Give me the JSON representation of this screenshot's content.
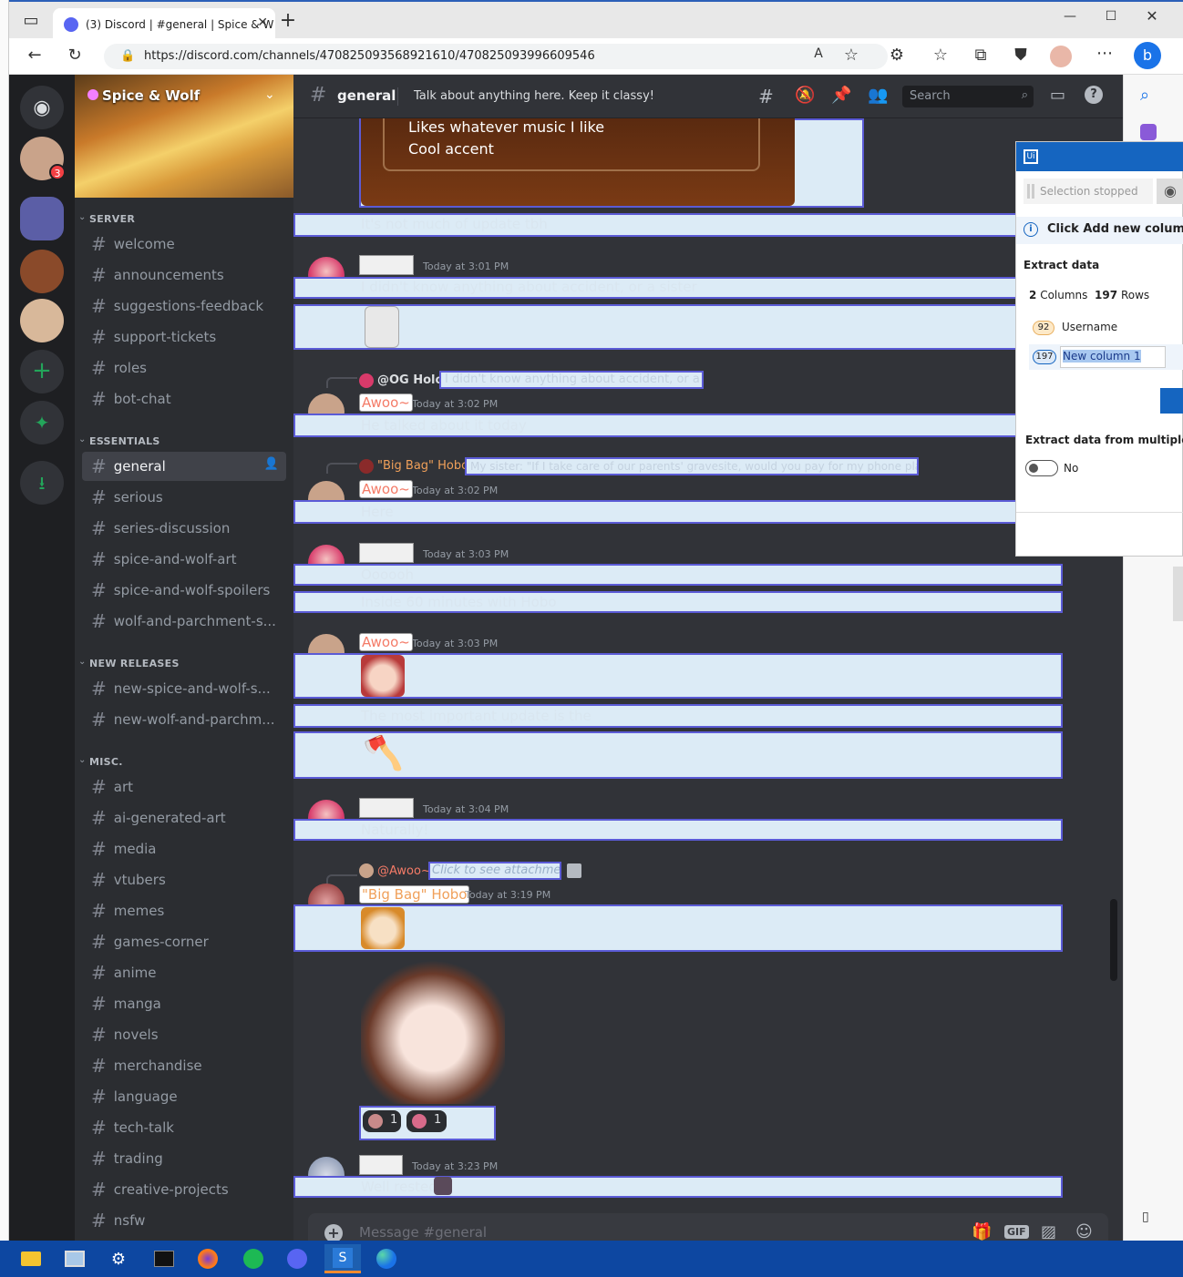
{
  "browser": {
    "tab_title": "(3) Discord | #general | Spice & W",
    "url": "https://discord.com/channels/470825093568921610/470825093996609546"
  },
  "server": {
    "name": "Spice & Wolf"
  },
  "guild_badge": "3",
  "categories": [
    {
      "name": "SERVER",
      "channels": [
        "welcome",
        "announcements",
        "suggestions-feedback",
        "support-tickets",
        "roles",
        "bot-chat"
      ]
    },
    {
      "name": "ESSENTIALS",
      "channels": [
        "general",
        "serious",
        "series-discussion",
        "spice-and-wolf-art",
        "spice-and-wolf-spoilers",
        "wolf-and-parchment-s..."
      ]
    },
    {
      "name": "NEW RELEASES",
      "channels": [
        "new-spice-and-wolf-s...",
        "new-wolf-and-parchm..."
      ]
    },
    {
      "name": "MISC.",
      "channels": [
        "art",
        "ai-generated-art",
        "media",
        "vtubers",
        "memes",
        "games-corner",
        "anime",
        "manga",
        "novels",
        "merchandise",
        "language",
        "tech-talk",
        "trading",
        "creative-projects",
        "nsfw"
      ]
    }
  ],
  "header": {
    "channel": "general",
    "topic": "Talk about anything here. Keep it classy!",
    "search_placeholder": "Search"
  },
  "messages": {
    "card_line1": "Likes whatever music I like",
    "card_line2": "Cool accent",
    "m1": "It's not much of update tbh",
    "m2_ts": "Today at 3:01 PM",
    "m2": "I didn't know anything about accident, or a sister",
    "r3_user": "@OG Holo",
    "r3_text": "I didn't know anything about accident, or a sister",
    "m3_user": "Awoo~",
    "m3_ts": "Today at 3:02 PM",
    "m3": "He talked about it today",
    "r4_user": "\"Big Bag\" Hobo",
    "r4_text": "My sister: \"If I take care of our parents' gravesite, would you pay for my phone plan?\"",
    "m4_user": "Awoo~",
    "m4_ts": "Today at 3:02 PM",
    "m4": "Here",
    "m5_ts": "Today at 3:03 PM",
    "m5a": "Oooooh",
    "m5b": "Inside 60 minutes with Hobo",
    "m6_user": "Awoo~",
    "m6_ts": "Today at 3:03 PM",
    "m6b": "The most important update is the",
    "m7_ts": "Today at 3:04 PM",
    "m7": "Naturally!",
    "r8_user": "@Awoo~",
    "r8_text": "Click to see attachment",
    "m8_user": "\"Big Bag\" Hobo",
    "m8_ts": "Today at 3:19 PM",
    "reaction1": "1",
    "reaction2": "1",
    "m9_ts": "Today at 3:23 PM",
    "m9": "Well rested"
  },
  "composer": {
    "placeholder": "Message #general",
    "gif": "GIF"
  },
  "uipath": {
    "status": "Selection stopped",
    "hint": "Click Add new column t",
    "section": "Extract data",
    "columns_count": "2",
    "columns_label": "Columns",
    "rows_count": "197",
    "rows_label": "Rows",
    "col1_count": "92",
    "col1_name": "Username",
    "col2_count": "197",
    "col2_name": "New column 1",
    "multi_label": "Extract data from multiple page",
    "toggle_value": "No"
  },
  "colors": {
    "discord_bg": "#313338",
    "highlight": "#dcebf6",
    "accent": "#5b5bd6",
    "taskbar": "#0d47a1"
  }
}
